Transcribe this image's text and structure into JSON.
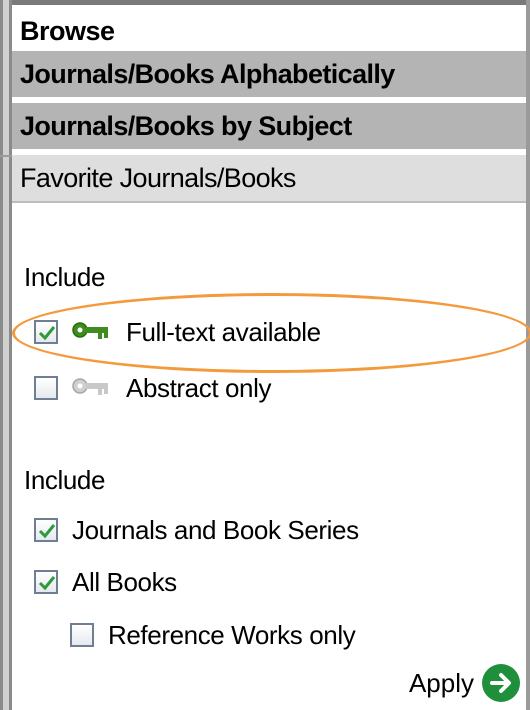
{
  "browse": {
    "title": "Browse"
  },
  "nav": [
    {
      "label": "Journals/Books Alphabetically"
    },
    {
      "label": "Journals/Books by Subject"
    },
    {
      "label": "Favorite Journals/Books"
    }
  ],
  "access_filter": {
    "label": "Include",
    "options": [
      {
        "label": "Full-text available",
        "checked": true,
        "icon": "green-key-icon"
      },
      {
        "label": "Abstract only",
        "checked": false,
        "icon": "gray-key-icon"
      }
    ]
  },
  "content_filter": {
    "label": "Include",
    "options": [
      {
        "label": "Journals and Book Series",
        "checked": true
      },
      {
        "label": "All Books",
        "checked": true
      },
      {
        "label": "Reference Works only",
        "checked": false
      }
    ]
  },
  "apply": {
    "label": "Apply",
    "icon": "arrow-right-icon"
  },
  "colors": {
    "highlight_oval": "#f39a3c",
    "check": "#2e9a3a",
    "nav_bg": "#b4b4b4",
    "nav_light_bg": "#dedede"
  }
}
